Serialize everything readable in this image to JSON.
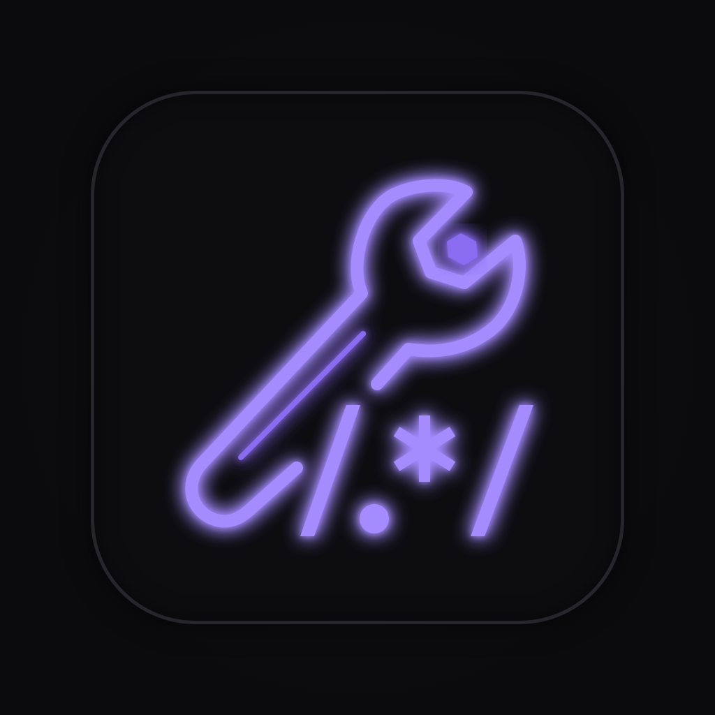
{
  "icon": {
    "name": "regex-wrench-app-icon",
    "symbols": [
      "wrench-icon",
      "regex-slash-dot-star-slash-icon"
    ],
    "colors": {
      "background": "#0c0c0e",
      "tile": "#0d0d10",
      "tile_border": "#26252b",
      "neon_stroke": "#a48cff",
      "neon_glow": "#7b4dff",
      "neon_fill": "#8a6cf0"
    }
  }
}
